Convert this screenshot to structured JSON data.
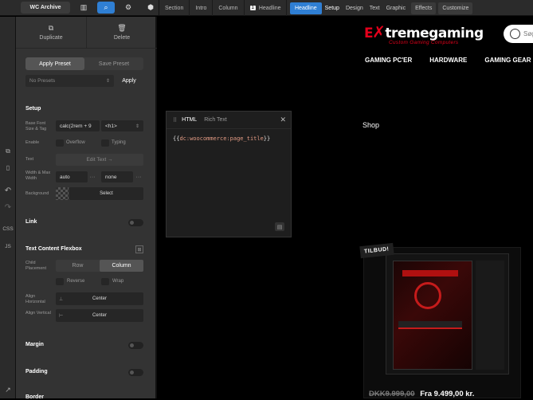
{
  "topbar": {
    "archive_label": "WC Archive",
    "breadcrumbs": [
      "Section",
      "Intro",
      "Column",
      "Headline"
    ],
    "active_num": "1",
    "tabs": [
      "Headline",
      "Setup",
      "Design",
      "Text",
      "Graphic",
      "Effects",
      "Customize"
    ]
  },
  "rail": {
    "css": "CSS",
    "js": "JS"
  },
  "panel": {
    "duplicate": "Duplicate",
    "delete": "Delete",
    "apply_preset": "Apply Preset",
    "save_preset": "Save Preset",
    "no_presets": "No Presets",
    "apply": "Apply",
    "setup_title": "Setup",
    "base_font_label": "Base Font Size & Tag",
    "base_font_value": "calc(2rem + 9",
    "tag_value": "<h1>",
    "enable_label": "Enable",
    "overflow": "Overflow",
    "typing": "Typing",
    "text_label": "Text",
    "edit_text": "Edit Text →",
    "width_label": "Width & Max Width",
    "width_value": "auto",
    "max_width_value": "none",
    "background_label": "Background",
    "select": "Select",
    "link": "Link",
    "flexbox_title": "Text Content Flexbox",
    "child_placement": "Child Placement",
    "row": "Row",
    "column": "Column",
    "reverse": "Reverse",
    "wrap": "Wrap",
    "align_h_label": "Align Horizontal",
    "align_h_value": "Center",
    "align_v_label": "Align Vertical",
    "align_v_value": "Center",
    "margin": "Margin",
    "padding": "Padding",
    "border": "Border"
  },
  "site": {
    "logo_main": "tremegaming",
    "logo_x": "E",
    "logo_tag": "Custom Gaming Computers",
    "search_placeholder": "Søg...",
    "nav": [
      "GAMING PC'ER",
      "HARDWARE",
      "GAMING GEAR"
    ],
    "shop_title": "Shop",
    "badge": "TILBUD!",
    "old_price": "DKK9.999,00",
    "price": "Fra 9.499,00 kr."
  },
  "editor": {
    "tab_html": "HTML",
    "tab_rich": "Rich Text",
    "code_prefix": "{{",
    "code_body": "dc:woocommerce:page_title",
    "code_suffix": "}}"
  }
}
